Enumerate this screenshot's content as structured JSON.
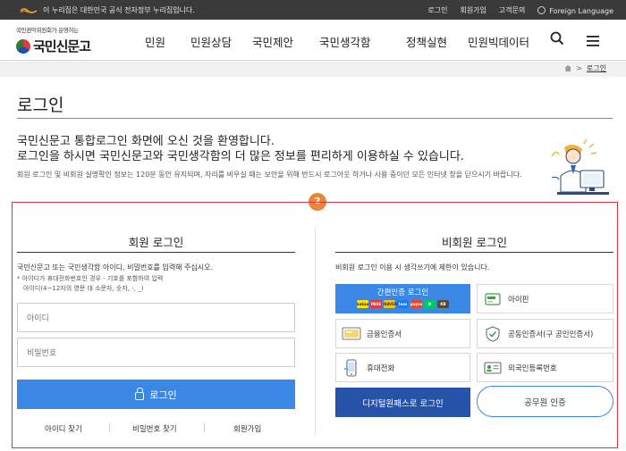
{
  "gov_banner": {
    "notice": "이 누리집은 대한민국 공식 전자정부 누리집입니다.",
    "links": [
      "로그인",
      "회원가입",
      "고객문의"
    ],
    "language": "Foreign Language"
  },
  "logo": {
    "subtitle": "국민권익위원회가 운영하는",
    "name": "국민신문고"
  },
  "nav": {
    "items": [
      "민원",
      "민원상담",
      "국민제안",
      "국민생각함",
      "정책실현",
      "민원빅데이터"
    ],
    "search_icon": "search-icon",
    "menu_icon": "hamburger-menu-icon"
  },
  "breadcrumb": {
    "home_icon": "home-icon",
    "current": "로그인"
  },
  "page_title": "로그인",
  "intro": {
    "line1": "국민신문고 통합로그인 화면에 오신 것을 환영합니다.",
    "line2": "로그인을 하시면 국민신문고와 국민생각함의 더 많은 정보를 편리하게 이용하실 수 있습니다.",
    "note": "회원 로그인 및 비회원 실명확인 정보는 120분 동안 유지되며, 자리를 비우실 때는 보안을 위해 반드시 로그아웃 하거나 사용 중이던 모든 인터넷 창을 닫으시기 바랍니다."
  },
  "step_badge": "2",
  "member": {
    "title": "회원 로그인",
    "desc": "국민신문고 또는 국민생각함 아이디, 비밀번호를 입력해 주십시오.",
    "hint1": "* 아이디가 휴대전화번호인 경우 - 기호를 포함하여 입력",
    "hint2": "아이디(4~12자의 영문 대 소문자, 숫자, -, _)",
    "id_placeholder": "아이디",
    "pw_placeholder": "비밀번호",
    "login_button": "로그인",
    "footer_links": [
      "아이디 찾기",
      "비밀번호 찾기",
      "회원가입"
    ]
  },
  "nonmember": {
    "title": "비회원 로그인",
    "desc": "비회원 로그인 이용 시 생각쓰기에 제한이 있습니다.",
    "easy_auth": {
      "label": "간편인증 로그인",
      "providers": [
        "kakao",
        "PASS",
        "NAVER",
        "toss",
        "payco",
        "N",
        "KB"
      ]
    },
    "ipin": "아이핀",
    "finance_cert": "금융인증서",
    "joint_cert": "공동인증서(구 공인인증서)",
    "mobile": "휴대전화",
    "foreigner": "외국인등록번호",
    "digital_onepass": "디지털원패스로 로그인",
    "civil_servant": "공무원 인증"
  },
  "colors": {
    "primary_blue": "#3a87e6",
    "dark_blue": "#2653a8",
    "red_outline": "#e0323a",
    "badge_orange": "#e8873a"
  }
}
